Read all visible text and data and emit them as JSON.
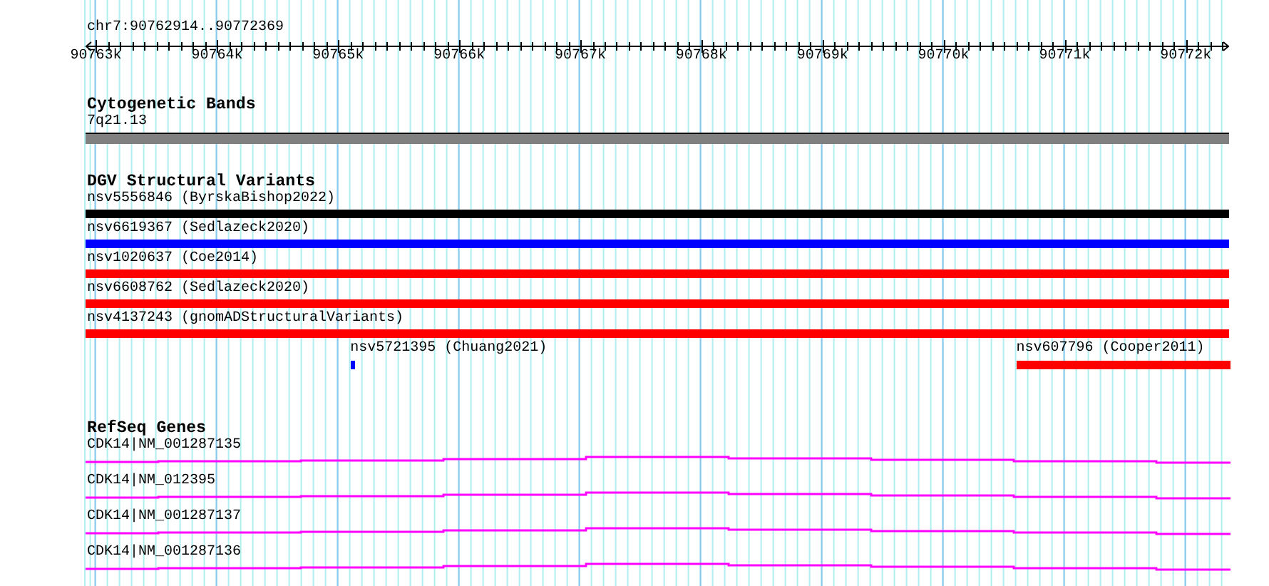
{
  "location": "chr7:90762914..90772369",
  "ruler": {
    "labels": [
      "90763k",
      "90764k",
      "90765k",
      "90766k",
      "90767k",
      "90768k",
      "90769k",
      "90770k",
      "90771k",
      "90772k"
    ]
  },
  "tracks": [
    {
      "kind": "band",
      "title": "Cytogenetic Bands",
      "rows": [
        [
          {
            "label": "7q21.13"
          }
        ]
      ]
    },
    {
      "kind": "variant",
      "title": "DGV Structural Variants",
      "rows": [
        [
          {
            "label": "nsv5556846 (ByrskaBishop2022)",
            "color": "#000000"
          }
        ],
        [
          {
            "label": "nsv6619367 (Sedlazeck2020)",
            "color": "#0000ff"
          }
        ],
        [
          {
            "label": "nsv1020637 (Coe2014)",
            "color": "#ff0000"
          }
        ],
        [
          {
            "label": "nsv6608762 (Sedlazeck2020)",
            "color": "#ff0000"
          }
        ],
        [
          {
            "label": "nsv4137243 (gnomADStructuralVariants)",
            "color": "#ff0000"
          }
        ],
        [
          {
            "label": "nsv5721395 (Chuang2021)",
            "color": "#0000ff"
          },
          {
            "label": "nsv607796 (Cooper2011)",
            "color": "#ff0000"
          }
        ]
      ]
    },
    {
      "kind": "gene",
      "title": "RefSeq Genes",
      "rows": [
        [
          {
            "label": "CDK14|NM_001287135"
          }
        ],
        [
          {
            "label": "CDK14|NM_012395"
          }
        ],
        [
          {
            "label": "CDK14|NM_001287137"
          }
        ],
        [
          {
            "label": "CDK14|NM_001287136"
          }
        ]
      ]
    }
  ]
}
